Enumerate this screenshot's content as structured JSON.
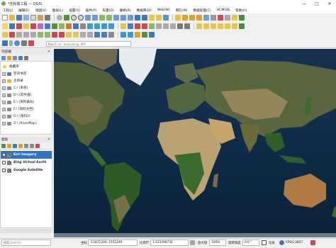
{
  "window": {
    "title": "*无标题工程 — QGIS",
    "minimize": "—",
    "maximize": "□",
    "close": "✕"
  },
  "menubar": [
    "工程(J)",
    "编辑(E)",
    "视图(V)",
    "图层(L)",
    "设置(S)",
    "插件(P)",
    "矢量(O)",
    "栅格(R)",
    "数据库(D)",
    "Web(W)",
    "网孔(M)",
    "数据处理(C)",
    "HCMGIS",
    "帮助(H)"
  ],
  "search": {
    "placeholder": "MapTiler Geocoding API"
  },
  "browser": {
    "title": "浏览器",
    "items": [
      {
        "label": "收藏夹",
        "icon": "star-icon",
        "expander": ""
      },
      {
        "label": "空间书签",
        "icon": "bookmark-icon",
        "expander": "+"
      },
      {
        "label": "主目录",
        "icon": "home-folder-icon",
        "expander": "+"
      },
      {
        "label": "C:\\ (系统)",
        "icon": "drive-icon",
        "expander": "+"
      },
      {
        "label": "D:\\ (软件盘)",
        "icon": "drive-icon",
        "expander": "+"
      },
      {
        "label": "E:\\ (资料备份)",
        "icon": "drive-icon",
        "expander": "+"
      },
      {
        "label": "F:\\ (资料文档)",
        "icon": "drive-icon",
        "expander": "+"
      },
      {
        "label": "G:\\ (资料2)",
        "icon": "drive-icon",
        "expander": "+"
      },
      {
        "label": "Z:\\ (RiverMap)",
        "icon": "drive-icon",
        "expander": "+"
      }
    ]
  },
  "layers": {
    "title": "图层",
    "items": [
      {
        "label": "Esri Imagery",
        "checked": true,
        "selected": true,
        "italic": false
      },
      {
        "label": "Bing Virtual Earth",
        "checked": false,
        "selected": false,
        "italic": true
      },
      {
        "label": "Google Satellite",
        "checked": false,
        "selected": false,
        "italic": true
      }
    ]
  },
  "status": {
    "locator_placeholder": "搜索 (Ctrl+K)",
    "coordinate_label": "坐标",
    "coordinate_value": "-11871204, 1551249",
    "scale_label": "比例尺",
    "scale_value": "1:123398732",
    "magnifier_label": "放大镜",
    "magnifier_value": "100%",
    "rotation_label": "旋转角度",
    "rotation_value": "0.0 °",
    "render_label": "渲染",
    "crs_label": "EPSG:3857"
  },
  "colors": {
    "selection": "#2f74c0",
    "ocean": "#0e2a44"
  }
}
